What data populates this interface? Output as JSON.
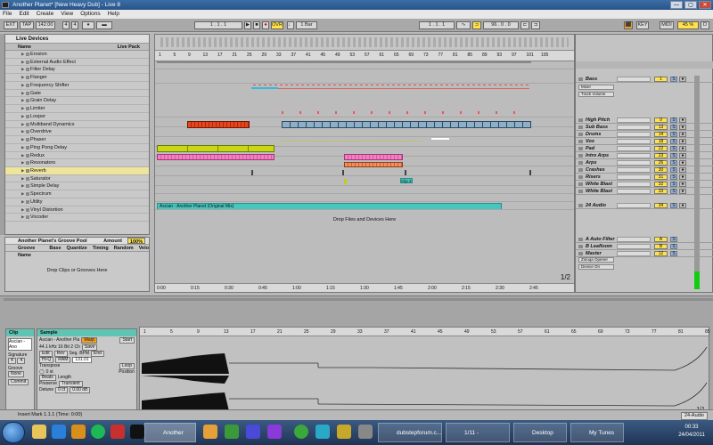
{
  "window": {
    "title": "Another Planet*  [New Heavy Dub] - Live 8",
    "buttons": [
      "—",
      "▢",
      "✕"
    ]
  },
  "menu": [
    "File",
    "Edit",
    "Create",
    "View",
    "Options",
    "Help"
  ],
  "transport": {
    "ext": "EXT",
    "tap": "TAP",
    "tempo": "142.00",
    "meter_num": "4",
    "meter_den": "4",
    "position": "1 . 1 . 1",
    "ovr": "OVR",
    "quant": "1 Bar",
    "loop_start": "1 . 1 . 1",
    "loop_len": "96 . 0 . 0",
    "key": "KEY",
    "midi": "MIDI",
    "cpu": "45 %",
    "d": "D"
  },
  "browser": {
    "title": "Live Devices",
    "col_name": "Name",
    "col_pack": "Live Pack",
    "items": [
      "Erosion",
      "External Audio Effect",
      "Filter Delay",
      "Flanger",
      "Frequency Shifter",
      "Gate",
      "Grain Delay",
      "Limiter",
      "Looper",
      "Multiband Dynamics",
      "Overdrive",
      "Phaser",
      "Ping Pong Delay",
      "Redux",
      "Resonators",
      "Reverb",
      "Saturator",
      "Simple Delay",
      "Spectrum",
      "Utility",
      "Vinyl Distortion",
      "Vocoder"
    ],
    "selected": "Reverb"
  },
  "groove": {
    "title": "Another Planet's Groove Pool",
    "amount_label": "Amount",
    "amount": "100%",
    "cols": [
      "Groove Name",
      "Base",
      "Quantize",
      "Timing",
      "Random",
      "Velo"
    ],
    "drop": "Drop Clips or Grooves Here"
  },
  "arrangement": {
    "ruler": [
      "1",
      "5",
      "9",
      "13",
      "17",
      "21",
      "25",
      "29",
      "33",
      "37",
      "41",
      "45",
      "49",
      "53",
      "57",
      "61",
      "65",
      "69",
      "73",
      "77",
      "81",
      "85",
      "89",
      "93",
      "97",
      "101",
      "105"
    ],
    "timeline": [
      "0:00",
      "0:15",
      "0:30",
      "0:45",
      "1:00",
      "1:15",
      "1:30",
      "1:45",
      "2:00",
      "2:15",
      "2:30",
      "2:45"
    ],
    "main_clip": "Ascian - Another Planet (Original Mix)",
    "drop": "Drop Files and Devices Here",
    "page": "1/2",
    "clip_label": "Clip 3"
  },
  "tracks": [
    {
      "name": "Bass",
      "num": "1",
      "io": "Master"
    },
    {
      "name": "High Pitch",
      "num": "9"
    },
    {
      "name": "Sub Bass",
      "num": "13"
    },
    {
      "name": "Drums",
      "num": "14"
    },
    {
      "name": "Vox",
      "num": "18"
    },
    {
      "name": "Pad",
      "num": "22"
    },
    {
      "name": "Intro Arps",
      "num": "23"
    },
    {
      "name": "Arps",
      "num": "26"
    },
    {
      "name": "Crashes",
      "num": "30"
    },
    {
      "name": "Risers",
      "num": "31"
    },
    {
      "name": "White Blast",
      "num": "32"
    },
    {
      "name": "White Blast",
      "num": "33"
    },
    {
      "name": "24 Audio",
      "num": "34"
    }
  ],
  "returns": [
    {
      "name": "A Auto Filter",
      "num": "A"
    },
    {
      "name": "B Leafloom",
      "num": "B"
    },
    {
      "name": "Master",
      "num": "12"
    }
  ],
  "bass_device": {
    "mixer": "Mixer",
    "param": "Track Volume"
  },
  "master_routing": {
    "in": "Zoloqa Opener",
    "out": "Device On"
  },
  "detail": {
    "clip": {
      "title": "Clip",
      "name": "Ascian - Ano",
      "signature_label": "Signature",
      "sig_num": "4",
      "sig_den": "4",
      "groove_label": "Groove",
      "groove": "None",
      "commit": "Commit"
    },
    "sample": {
      "title": "Sample",
      "name": "Ascian - Another Pla",
      "warp": "Warp",
      "info": "44.1 kHz 16 Bit 2 Ch",
      "save": "Save",
      "edit": "Edit",
      "rev": "Rev",
      "hiq": "Hi-Q",
      "ram": "RAM",
      "seg_bpm_label": "Seg. BPM",
      "seg_bpm": "131.01",
      "transpose_label": "Transpose",
      "transpose": "0 st",
      "detune_label": "Detune",
      "detune": "0 ct",
      "gain": "0.00 dB",
      "start_label": "Start",
      "start": "1 . 1 . 1",
      "end_label": "End",
      "end": "96 . 0 . 0",
      "loop": "Loop",
      "position_label": "Position",
      "length_label": "Length",
      "beats": "Beats",
      "preserve_label": "Preserve",
      "transient": "Transient"
    },
    "ruler": [
      "1",
      "5",
      "9",
      "13",
      "17",
      "21",
      "25",
      "29",
      "33",
      "37",
      "41",
      "45",
      "49",
      "53",
      "57",
      "61",
      "65",
      "69",
      "73",
      "77",
      "81",
      "85"
    ],
    "page": "1/1"
  },
  "status": {
    "left": "Insert Mark 1.1.1 (Time: 0:00)",
    "right": "24-Audio"
  },
  "taskbar": {
    "tasks": [
      "Another Planet*...",
      "dubstepforum.c...",
      "1/11 - DownThe...",
      "Desktop",
      "My Tunes"
    ],
    "time": "00:33",
    "date": "24/04/2011"
  }
}
